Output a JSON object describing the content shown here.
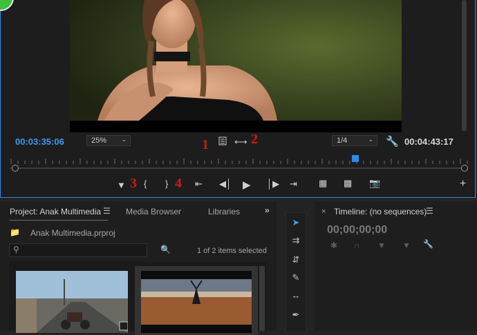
{
  "monitor": {
    "timecode_current": "00:03:35:06",
    "timecode_duration": "00:04:43:17",
    "zoom_value": "25%",
    "resolution_value": "1/4",
    "annotations": [
      "1",
      "2",
      "3",
      "4"
    ]
  },
  "project_panel": {
    "tabs": [
      "Project: Anak Multimedia",
      "Media Browser",
      "Libraries"
    ],
    "file_name": "Anak Multimedia.prproj",
    "search_placeholder": "",
    "selection_status": "1 of 2 items selected"
  },
  "timeline_panel": {
    "title": "Timeline: (no sequences)",
    "timecode": "00;00;00;00"
  },
  "colors": {
    "accent_blue": "#2d8ceb",
    "annotation_red": "#d01818",
    "panel_bg": "#1e1e1e"
  },
  "icons": [
    "mark-in-icon",
    "mark-out-icon",
    "go-to-in-icon",
    "step-back-icon",
    "play-icon",
    "step-forward-icon",
    "go-to-out-icon",
    "insert-icon",
    "overwrite-icon",
    "export-frame-icon",
    "add-button-icon",
    "settings-wrench-icon",
    "selection-tool-icon"
  ]
}
